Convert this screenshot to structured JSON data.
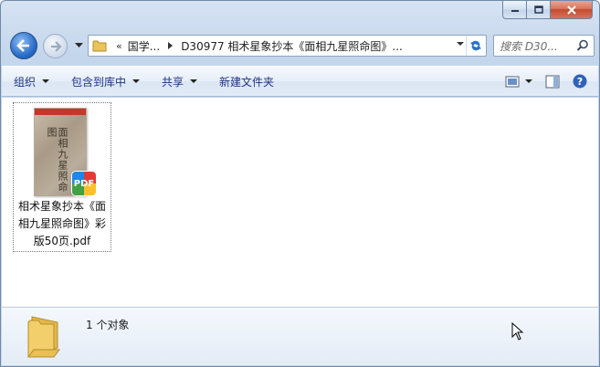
{
  "window": {
    "caption_buttons": [
      "minimize-icon",
      "maximize-icon",
      "close-icon"
    ]
  },
  "nav": {
    "address": {
      "overflow": "«",
      "crumbs": [
        "国学...",
        "D30977 相术星象抄本《面相九星照命图》..."
      ]
    },
    "search_placeholder": "搜索 D30..."
  },
  "toolbar": {
    "organize": "组织",
    "include_library": "包含到库中",
    "share": "共享",
    "new_folder": "新建文件夹"
  },
  "files": [
    {
      "name": "相术星象抄本《面相九星照命图》彩版50页.pdf",
      "thumb_text": "面相九星照命图",
      "badge": "PDF"
    }
  ],
  "status": {
    "count_text": "1 个对象"
  },
  "colors": {
    "toolbar_text": "#1e3287",
    "close_button": "#c44a2d",
    "accent_blue": "#2c6ec9"
  }
}
